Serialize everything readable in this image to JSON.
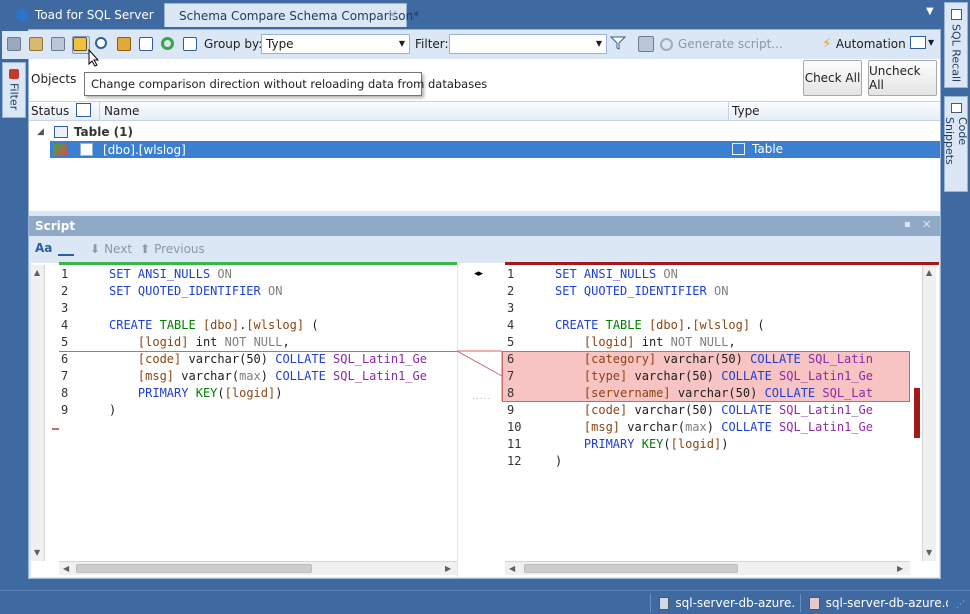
{
  "tabs": [
    {
      "label": "Toad for SQL Server"
    },
    {
      "label": "Schema Compare Schema Comparison*"
    }
  ],
  "toolbar": {
    "group_by_label": "Group by:",
    "group_by_value": "Type",
    "filter_label": "Filter:",
    "filter_value": "",
    "generate_script": "Generate script...",
    "automation": "Automation",
    "tooltip": "Change comparison direction without reloading data from databases"
  },
  "objects": {
    "label": "Objects",
    "check_all": "Check All",
    "uncheck_all": "Uncheck All",
    "columns": {
      "status": "Status",
      "name": "Name",
      "type": "Type"
    },
    "group": "Table (1)",
    "row": {
      "name": "[dbo].[wlslog]",
      "type": "Table"
    }
  },
  "script": {
    "title": "Script",
    "next": "Next",
    "previous": "Previous"
  },
  "side": {
    "filter": "Filter",
    "sql_recall": "SQL Recall",
    "code_snippets": "Code Snippets"
  },
  "status": {
    "conn1": "sql-server-db-azure.d",
    "conn2": "sql-server-db-azure.d"
  },
  "left_code": [
    {
      "n": "1",
      "t": "SET ANSI_NULLS ON"
    },
    {
      "n": "2",
      "t": "SET QUOTED_IDENTIFIER ON"
    },
    {
      "n": "3",
      "t": ""
    },
    {
      "n": "4",
      "t": "CREATE TABLE [dbo].[wlslog] ("
    },
    {
      "n": "5",
      "t": "    [logid] int NOT NULL,"
    },
    {
      "n": "6",
      "t": "    [code] varchar(50) COLLATE SQL_Latin1_Ge"
    },
    {
      "n": "7",
      "t": "    [msg] varchar(max) COLLATE SQL_Latin1_Ge"
    },
    {
      "n": "8",
      "t": "    PRIMARY KEY([logid])"
    },
    {
      "n": "9",
      "t": ")"
    }
  ],
  "right_code": [
    {
      "n": "1",
      "t": "SET ANSI_NULLS ON"
    },
    {
      "n": "2",
      "t": "SET QUOTED_IDENTIFIER ON"
    },
    {
      "n": "3",
      "t": ""
    },
    {
      "n": "4",
      "t": "CREATE TABLE [dbo].[wlslog] ("
    },
    {
      "n": "5",
      "t": "    [logid] int NOT NULL,"
    },
    {
      "n": "6",
      "t": "    [category] varchar(50) COLLATE SQL_Latin"
    },
    {
      "n": "7",
      "t": "    [type] varchar(50) COLLATE SQL_Latin1_Ge"
    },
    {
      "n": "8",
      "t": "    [servername] varchar(50) COLLATE SQL_Lat"
    },
    {
      "n": "9",
      "t": "    [code] varchar(50) COLLATE SQL_Latin1_Ge"
    },
    {
      "n": "10",
      "t": "    [msg] varchar(max) COLLATE SQL_Latin1_Ge"
    },
    {
      "n": "11",
      "t": "    PRIMARY KEY([logid])"
    },
    {
      "n": "12",
      "t": ")"
    }
  ],
  "colors": {
    "accent": "#3f6aa1",
    "selection": "#3b7fd1",
    "diff": "#f7c3c3",
    "left_bar": "#39b54a",
    "right_bar": "#a31919"
  }
}
